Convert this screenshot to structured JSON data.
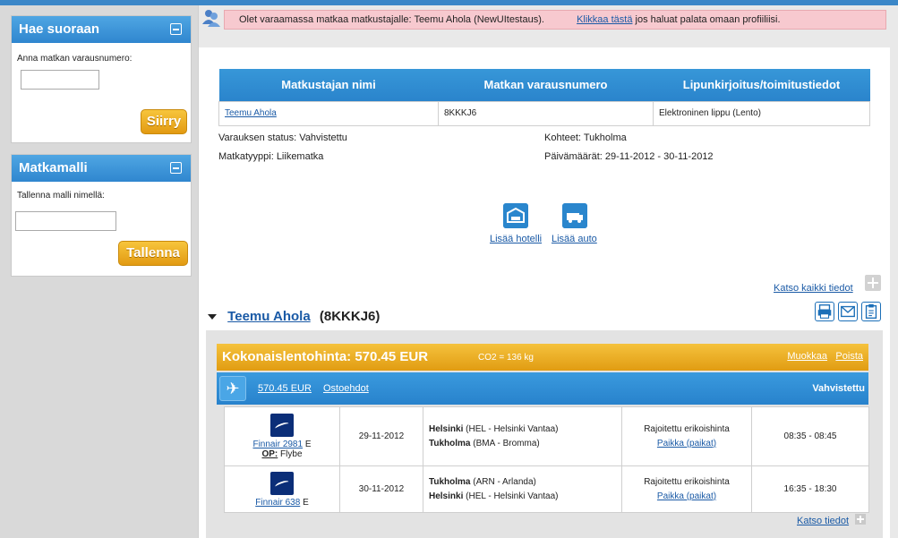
{
  "left": {
    "search": {
      "title": "Hae suoraan",
      "label": "Anna matkan varausnumero:",
      "input_value": "",
      "button": "Siirry"
    },
    "template": {
      "title": "Matkamalli",
      "label": "Tallenna malli nimellä:",
      "input_value": "",
      "button": "Tallenna"
    }
  },
  "notice": {
    "text": "Olet varaamassa matkaa matkustajalle: Teemu Ahola  (NewUItestaus).",
    "link": "Klikkaa  tästä",
    "suffix": "jos haluat palata omaan profiiliisi."
  },
  "traveler_table": {
    "headers": [
      "Matkustajan nimi",
      "Matkan varausnumero",
      "Lipunkirjoitus/toimitustiedot"
    ],
    "row": {
      "name": "Teemu Ahola",
      "booking": "8KKKJ6",
      "ticket": "Elektroninen lippu (Lento)"
    }
  },
  "info": {
    "status_label": "Varauksen status:",
    "status_value": "Vahvistettu",
    "type_label": "Matkatyyppi:",
    "type_value": "Liikematka",
    "dest_label": "Kohteet:",
    "dest_value": "Tukholma",
    "dates_label": "Päivämäärät:",
    "dates_value": "29-11-2012 - 30-11-2012"
  },
  "actions": {
    "hotel": "Lisää hotelli",
    "car": "Lisää auto"
  },
  "all_details": "Katso kaikki tiedot",
  "trip": {
    "name": "Teemu Ahola",
    "code": "(8KKKJ6)"
  },
  "price_bar": {
    "total": "Kokonaislentohinta: 570.45 EUR",
    "co2": "CO2 = 136 kg",
    "edit": "Muokkaa",
    "delete": "Poista"
  },
  "fare_bar": {
    "price": "570.45 EUR",
    "terms": "Ostoehdot",
    "status": "Vahvistettu"
  },
  "flights": [
    {
      "airline": "Finnair  2981",
      "class": "E",
      "op_label": "OP:",
      "op_value": "Flybe",
      "date": "29-11-2012",
      "from_city": "Helsinki",
      "from_detail": "(HEL - Helsinki Vantaa)",
      "to_city": "Tukholma",
      "to_detail": "(BMA - Bromma)",
      "fare": "Rajoitettu erikoishinta",
      "seat": "Paikka (paikat)",
      "time": "08:35 - 08:45"
    },
    {
      "airline": "Finnair  638",
      "class": "E",
      "op_label": "",
      "op_value": "",
      "date": "30-11-2012",
      "from_city": "Tukholma",
      "from_detail": "(ARN - Arlanda)",
      "to_city": "Helsinki",
      "to_detail": "(HEL - Helsinki Vantaa)",
      "fare": "Rajoitettu erikoishinta",
      "seat": "Paikka (paikat)",
      "time": "16:35 - 18:30"
    }
  ],
  "footer_link": "Katso tiedot"
}
